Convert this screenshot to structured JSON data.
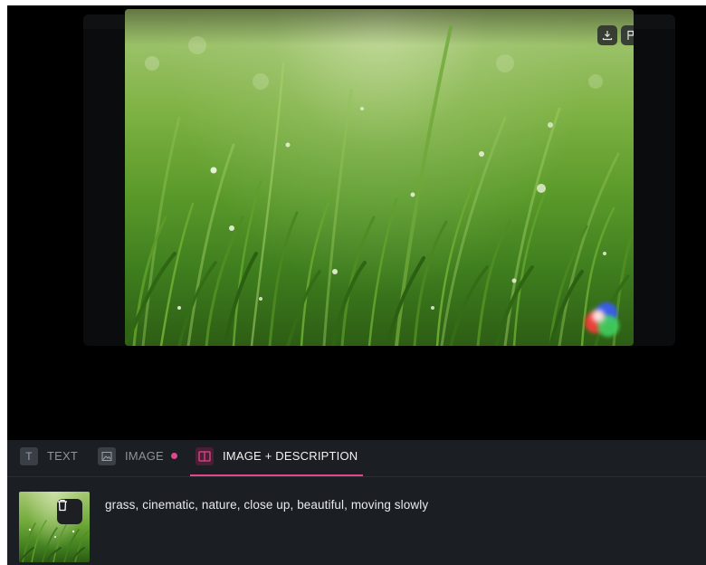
{
  "player": {
    "controls": [
      {
        "name": "download-icon"
      },
      {
        "name": "flag-icon"
      },
      {
        "name": "fullscreen-icon"
      }
    ]
  },
  "tabs": [
    {
      "label": "TEXT",
      "icon": "text-icon",
      "active": false
    },
    {
      "label": "IMAGE",
      "icon": "image-icon",
      "active": false,
      "indicator": true
    },
    {
      "label": "IMAGE + DESCRIPTION",
      "icon": "split-view-icon",
      "active": true
    }
  ],
  "editor": {
    "prompt": "grass, cinematic, nature, close up, beautiful, moving slowly",
    "thumbnail_action": "trash-icon"
  },
  "colors": {
    "accent": "#e0478d",
    "panel_bg": "#1b1e22",
    "page_bg": "#000000"
  }
}
